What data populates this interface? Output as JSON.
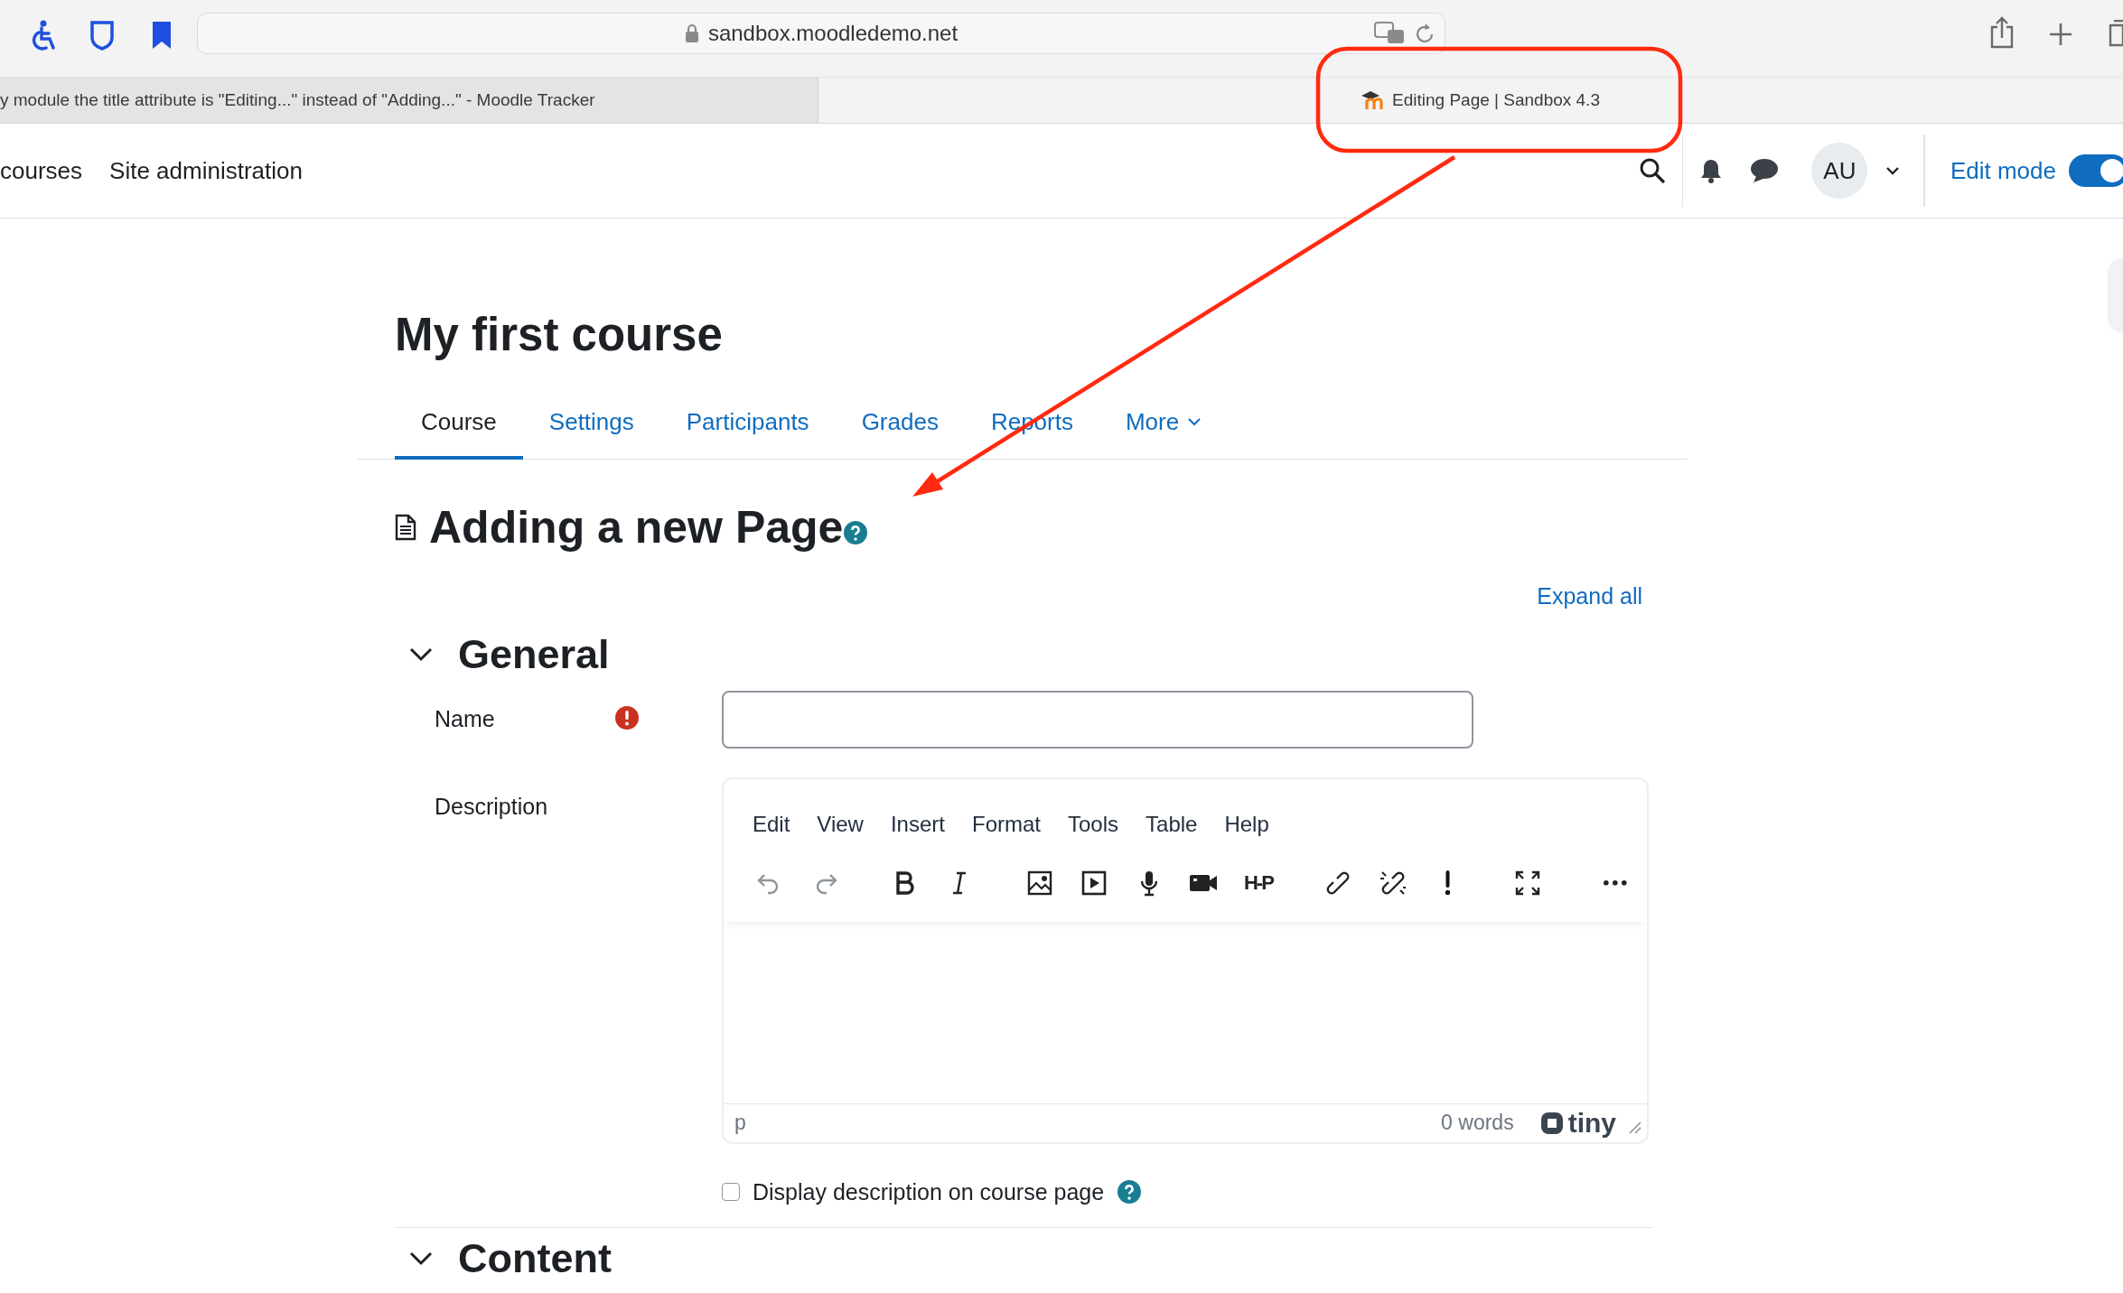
{
  "browser": {
    "url": "sandbox.moodledemo.net",
    "tabs": [
      {
        "title": "y module the title attribute is \"Editing...\" instead of \"Adding...\" - Moodle Tracker",
        "selected": false
      },
      {
        "title": "Editing Page | Sandbox 4.3",
        "selected": true
      }
    ]
  },
  "navbar": {
    "items": [
      {
        "label": "courses"
      },
      {
        "label": "Site administration"
      }
    ],
    "avatar": "AU",
    "edit_mode": {
      "label": "Edit mode",
      "on": true
    }
  },
  "course_title": "My first course",
  "course_tabs": [
    {
      "label": "Course",
      "selected": true,
      "kind": "link"
    },
    {
      "label": "Settings",
      "selected": false,
      "kind": "link"
    },
    {
      "label": "Participants",
      "selected": false,
      "kind": "link"
    },
    {
      "label": "Grades",
      "selected": false,
      "kind": "link"
    },
    {
      "label": "Reports",
      "selected": false,
      "kind": "link"
    },
    {
      "label": "More",
      "selected": false,
      "kind": "dropdown"
    }
  ],
  "page_heading": "Adding a new Page",
  "expand_all": "Expand all",
  "sections": [
    {
      "title": "General",
      "expanded": true
    },
    {
      "title": "Content",
      "expanded": true
    }
  ],
  "form": {
    "name": {
      "label": "Name",
      "required": true
    },
    "description": {
      "label": "Description",
      "editor": {
        "menu": [
          "Edit",
          "View",
          "Insert",
          "Format",
          "Tools",
          "Table",
          "Help"
        ],
        "h5p_button": "H-P",
        "path": "p",
        "word_count": "0 words",
        "brand": "tiny"
      }
    },
    "show_description": {
      "label": "Display description on course page",
      "checked": false
    }
  }
}
